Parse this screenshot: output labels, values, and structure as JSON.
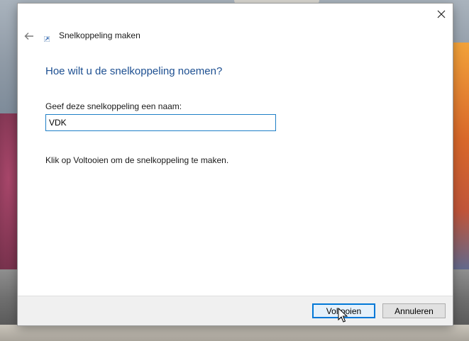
{
  "window": {
    "title": "Snelkoppeling maken",
    "close_icon": "close-icon",
    "back_icon": "back-arrow-icon"
  },
  "main": {
    "heading": "Hoe wilt u de snelkoppeling noemen?",
    "name_label": "Geef deze snelkoppeling een naam:",
    "name_value": "VDK",
    "hint": "Klik op Voltooien om de snelkoppeling te maken."
  },
  "footer": {
    "finish_label": "Voltooien",
    "cancel_label": "Annuleren"
  },
  "colors": {
    "heading": "#1d4f91",
    "input_border": "#1f7fc7",
    "primary_button_border": "#0078d7"
  }
}
